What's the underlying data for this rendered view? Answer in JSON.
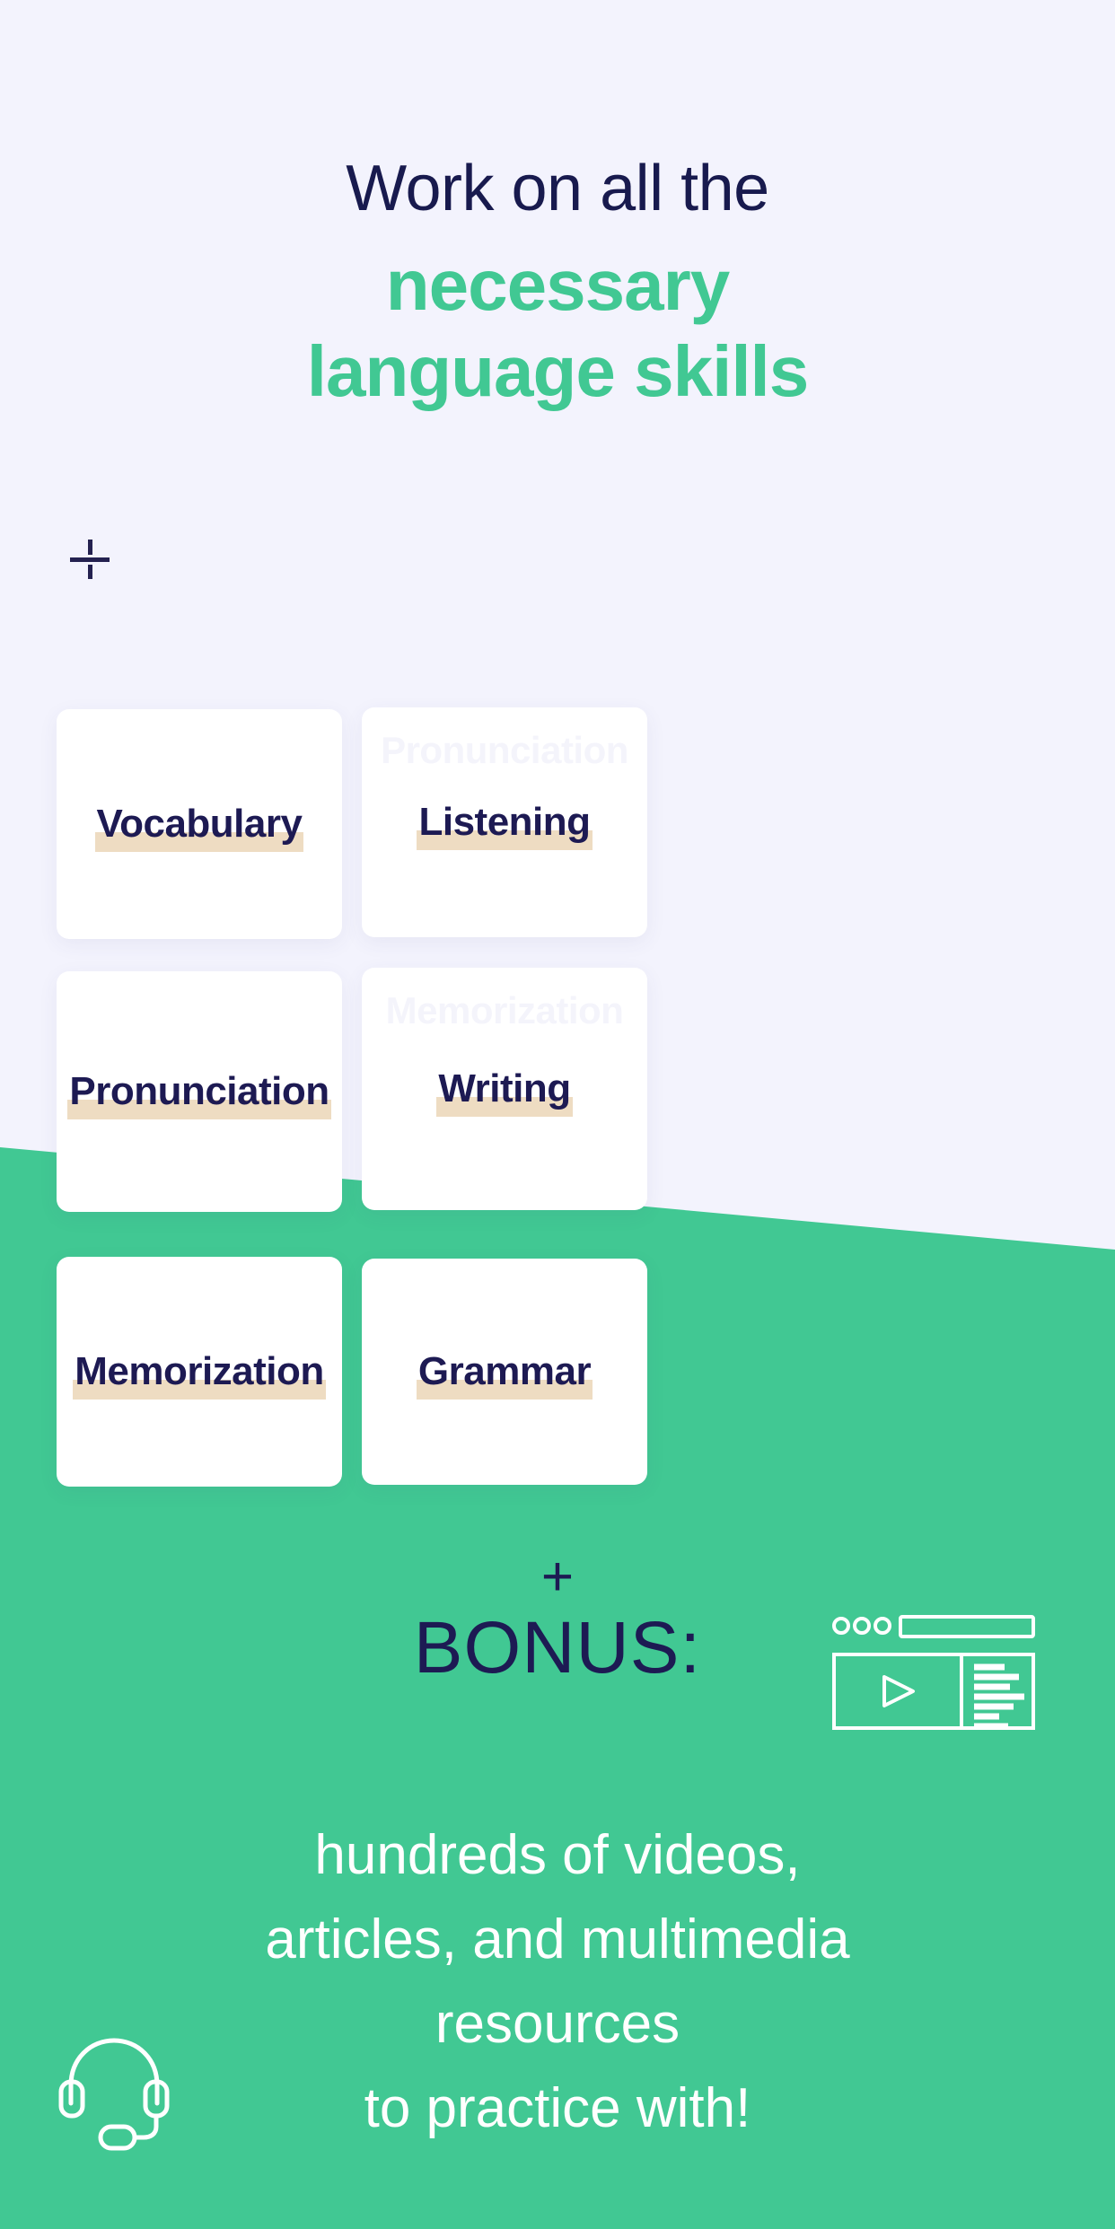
{
  "theme": {
    "background": "#f3f3fd",
    "accent_green": "#41c893",
    "navy": "#1d1a53",
    "highlight_beige": "#eedcc2",
    "card_white": "#ffffff",
    "text_white": "#ffffff"
  },
  "headline": {
    "line1": "Work on all the",
    "line2": "necessary",
    "line3": "language skills"
  },
  "marks": {
    "crosshair": "crosshair-mark"
  },
  "cards": [
    {
      "id": "vocabulary",
      "label": "Vocabulary",
      "ghost": ""
    },
    {
      "id": "listening",
      "label": "Listening",
      "ghost": "Pronunciation"
    },
    {
      "id": "pronunciation",
      "label": "Pronunciation",
      "ghost": ""
    },
    {
      "id": "writing",
      "label": "Writing",
      "ghost": "Memorization"
    },
    {
      "id": "memorization",
      "label": "Memorization",
      "ghost": ""
    },
    {
      "id": "grammar",
      "label": "Grammar",
      "ghost": ""
    }
  ],
  "bonus": {
    "plus": "+",
    "word": "BONUS:",
    "icon": "browser-video-window-icon",
    "copy_line1": "hundreds of videos,",
    "copy_line2": "articles, and multimedia",
    "copy_line3": "resources",
    "copy_line4": "to practice with!",
    "footer_icon": "headset-icon"
  }
}
